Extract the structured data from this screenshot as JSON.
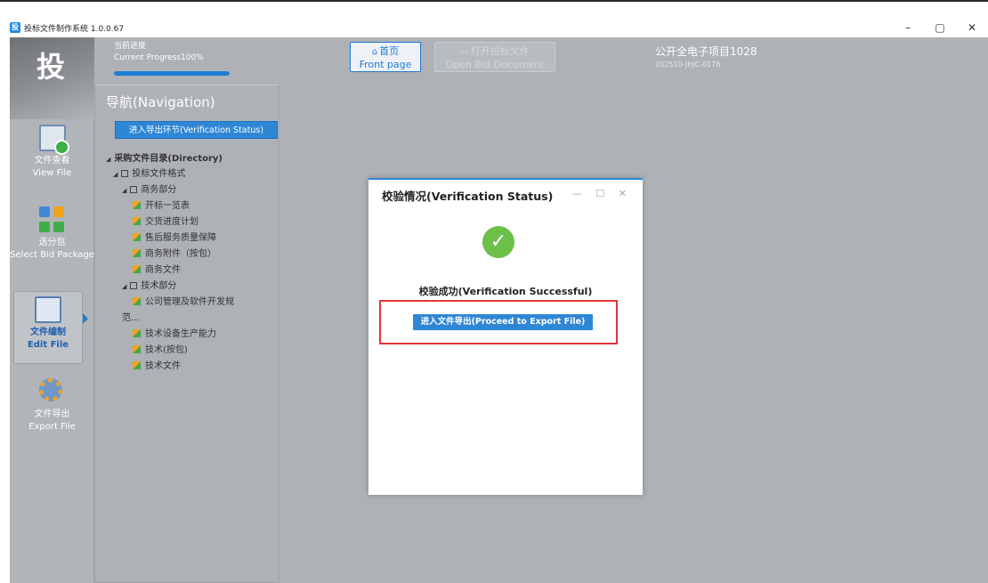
{
  "window": {
    "title": "投标文件制作系统 1.0.0.67",
    "logo_char": "投",
    "controls": [
      "–",
      "▢",
      "✕"
    ]
  },
  "header": {
    "progress_label_cn": "当前进度",
    "progress_label_en": "Current Progress100%",
    "progress_fraction": 1.0,
    "front_page_cn": "首页",
    "front_page_en": "Front page",
    "open_bid_cn": "打开招标文件",
    "open_bid_en": "Open Bid Document",
    "project_name": "公开全电子项目1028",
    "project_code": "202510-JHJC-0176"
  },
  "sidebar": {
    "logo": "投",
    "items": [
      {
        "cn": "文件查看",
        "en": "View File"
      },
      {
        "cn": "选分包",
        "en": "Select Bid Package"
      },
      {
        "cn": "文件编制",
        "en": "Edit File"
      },
      {
        "cn": "文件导出",
        "en": "Export File"
      }
    ]
  },
  "navigation": {
    "title": "导航(Navigation)",
    "verify_button": "进入导出环节(Verification Status)",
    "tree": [
      "采购文件目录(Directory)",
      "投标文件格式",
      "商务部分",
      "开标一览表",
      "交货进度计划",
      "售后服务质量保障",
      "商务附件（按包）",
      "商务文件",
      "技术部分",
      "公司管理及软件开发规",
      "范...",
      "技术设备生产能力",
      "技术(按包)",
      "技术文件"
    ]
  },
  "modal": {
    "title": "校验情况(Verification Status)",
    "controls": "— ☐ ✕",
    "success_icon": "✓",
    "message": "校验成功(Verification Successful)",
    "proceed_button": "进入文件导出(Proceed to Export File)"
  },
  "colors": {
    "accent": "#2f86d5",
    "success": "#6cc04a",
    "highlight": "#e5353a",
    "overlay": "#aeb1b5"
  }
}
